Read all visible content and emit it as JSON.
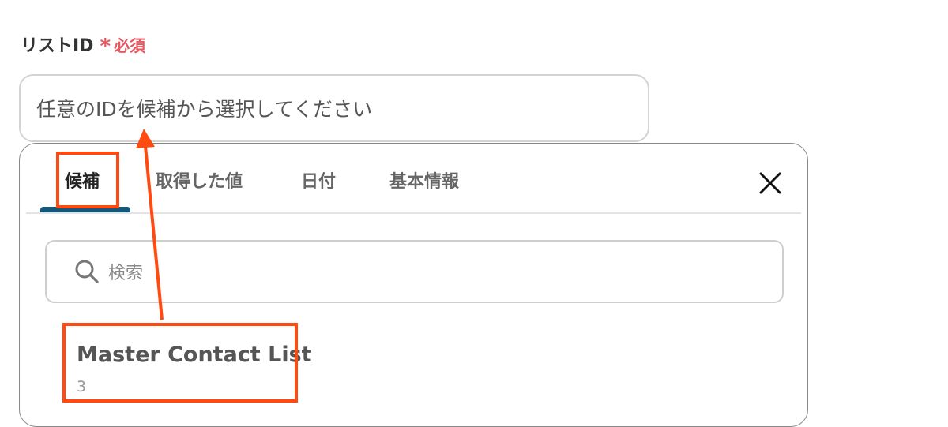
{
  "field": {
    "label": "リストID",
    "asterisk": "*",
    "required": "必須"
  },
  "id_input": {
    "placeholder": "任意のIDを候補から選択してください"
  },
  "panel": {
    "tabs": [
      {
        "label": "候補",
        "active": true
      },
      {
        "label": "取得した値",
        "active": false
      },
      {
        "label": "日付",
        "active": false
      },
      {
        "label": "基本情報",
        "active": false
      }
    ],
    "close_icon": "close-icon",
    "search": {
      "placeholder": "検索",
      "icon": "search-icon"
    },
    "candidates": [
      {
        "title": "Master Contact List",
        "sub": "3"
      }
    ]
  },
  "annotation": {
    "color": "#ff4a12",
    "accent": "#12587a",
    "required_color": "#e8565f"
  }
}
